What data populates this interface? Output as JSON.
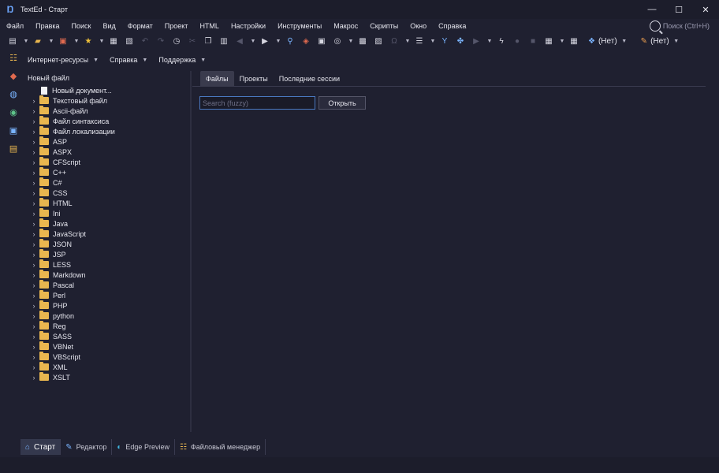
{
  "window": {
    "title": "TextEd - Старт",
    "minimize": "—",
    "maximize": "☐",
    "close": "✕"
  },
  "menu": {
    "items": [
      "Файл",
      "Правка",
      "Поиск",
      "Вид",
      "Формат",
      "Проект",
      "HTML",
      "Настройки",
      "Инструменты",
      "Макрос",
      "Скрипты",
      "Окно",
      "Справка"
    ],
    "search_placeholder": "Поиск (Ctrl+H)"
  },
  "toolbar": {
    "combo1_label": "(Нет)",
    "combo2_label": "(Нет)"
  },
  "subbar": {
    "items": [
      "Интернет-ресурсы",
      "Справка",
      "Поддержка"
    ]
  },
  "tree": {
    "header": "Новый файл",
    "new_document": "Новый документ...",
    "folders": [
      "Текстовый файл",
      "Ascii-файл",
      "Файл синтаксиса",
      "Файл локализации",
      "ASP",
      "ASPX",
      "CFScript",
      "C++",
      "C#",
      "CSS",
      "HTML",
      "Ini",
      "Java",
      "JavaScript",
      "JSON",
      "JSP",
      "LESS",
      "Markdown",
      "Pascal",
      "Perl",
      "PHP",
      "python",
      "Reg",
      "SASS",
      "VBNet",
      "VBScript",
      "XML",
      "XSLT"
    ]
  },
  "main": {
    "tabs": [
      "Файлы",
      "Проекты",
      "Последние сессии"
    ],
    "search_placeholder": "Search (fuzzy)",
    "open_button": "Открыть"
  },
  "bottom_tabs": [
    "Старт",
    "Редактор",
    "Edge Preview",
    "Файловый менеджер"
  ],
  "colors": {
    "background": "#1f2030",
    "accent": "#4a78c0",
    "folder": "#e9b64f"
  }
}
